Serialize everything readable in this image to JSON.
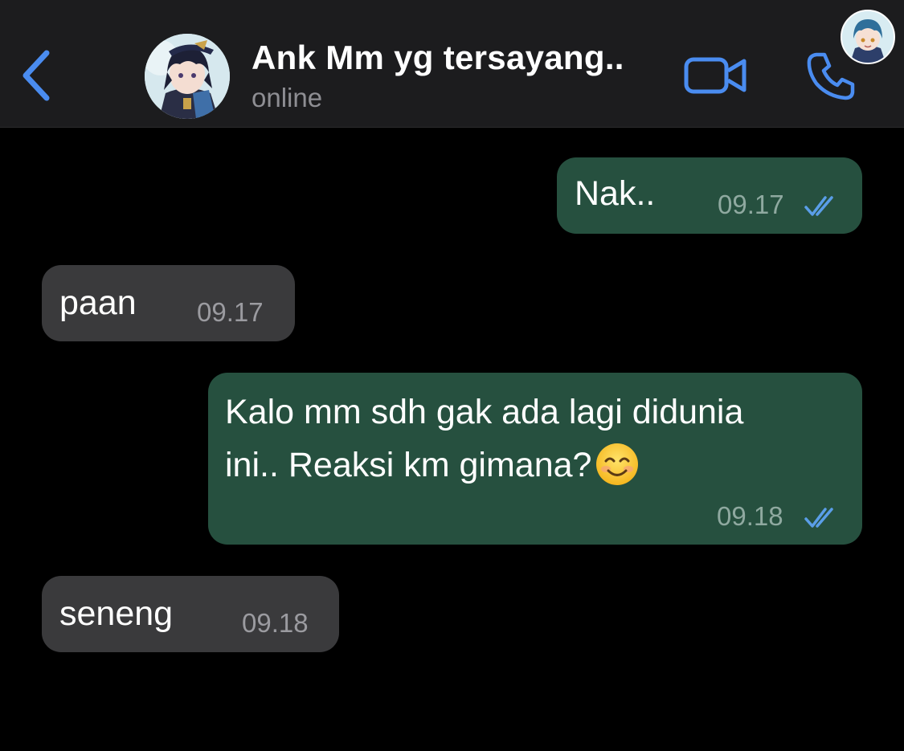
{
  "header": {
    "title": "Ank Mm yg tersayang..",
    "status": "online",
    "back_icon": "chevron-left-icon",
    "video_icon": "video-camera-icon",
    "call_icon": "phone-icon",
    "accent_color": "#4a8cf0"
  },
  "messages": [
    {
      "direction": "outgoing",
      "text": "Nak..",
      "time": "09.17",
      "status": "read"
    },
    {
      "direction": "incoming",
      "text": "paan",
      "time": "09.17"
    },
    {
      "direction": "outgoing",
      "lines": [
        "Kalo mm sdh gak ada lagi didunia",
        "ini.. Reaksi km gimana?"
      ],
      "emoji": "smiling-face-emoji",
      "time": "09.18",
      "status": "read"
    },
    {
      "direction": "incoming",
      "text": "seneng",
      "time": "09.18"
    }
  ],
  "colors": {
    "outgoing_bubble": "#26503f",
    "incoming_bubble": "#3a3a3c",
    "read_ticks": "#5a9ee8",
    "header_bg": "#1c1c1e",
    "chat_bg": "#000000"
  }
}
